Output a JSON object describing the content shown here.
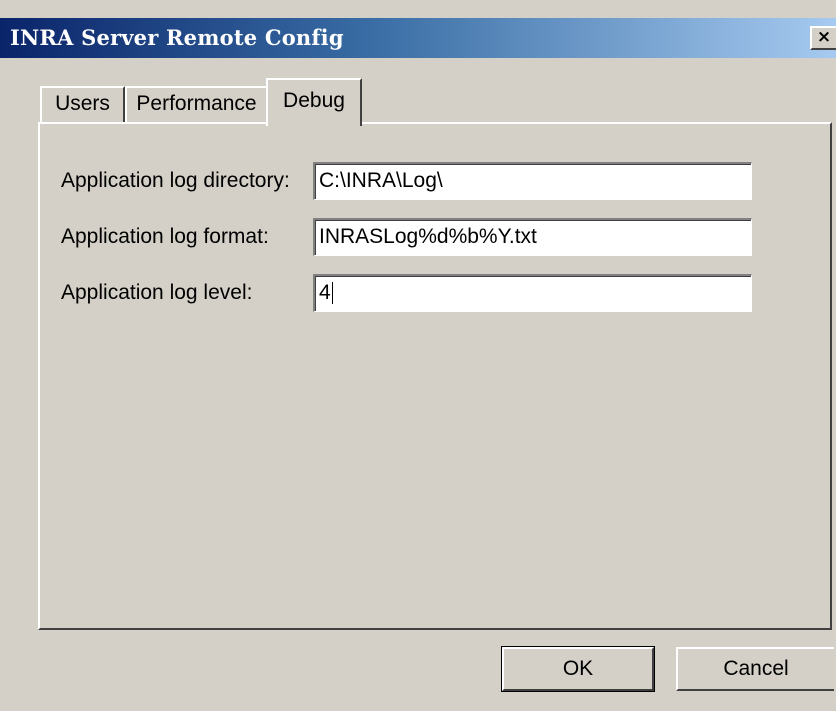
{
  "window": {
    "title": "INRA Server Remote Config",
    "close_label": "×"
  },
  "tabs": [
    {
      "label": "Users",
      "selected": false
    },
    {
      "label": "Performance",
      "selected": false
    },
    {
      "label": "Debug",
      "selected": true
    }
  ],
  "debug": {
    "fields": [
      {
        "label": "Application log directory:",
        "value": "C:\\INRA\\Log\\"
      },
      {
        "label": "Application log format:",
        "value": "INRASLog%d%b%Y.txt"
      },
      {
        "label": "Application log level:",
        "value": "4"
      }
    ]
  },
  "buttons": {
    "ok_label": "OK",
    "cancel_label": "Cancel"
  },
  "colors": {
    "titlebar_start": "#0a246a",
    "titlebar_end": "#a6caf0",
    "face": "#d4d0c8"
  }
}
